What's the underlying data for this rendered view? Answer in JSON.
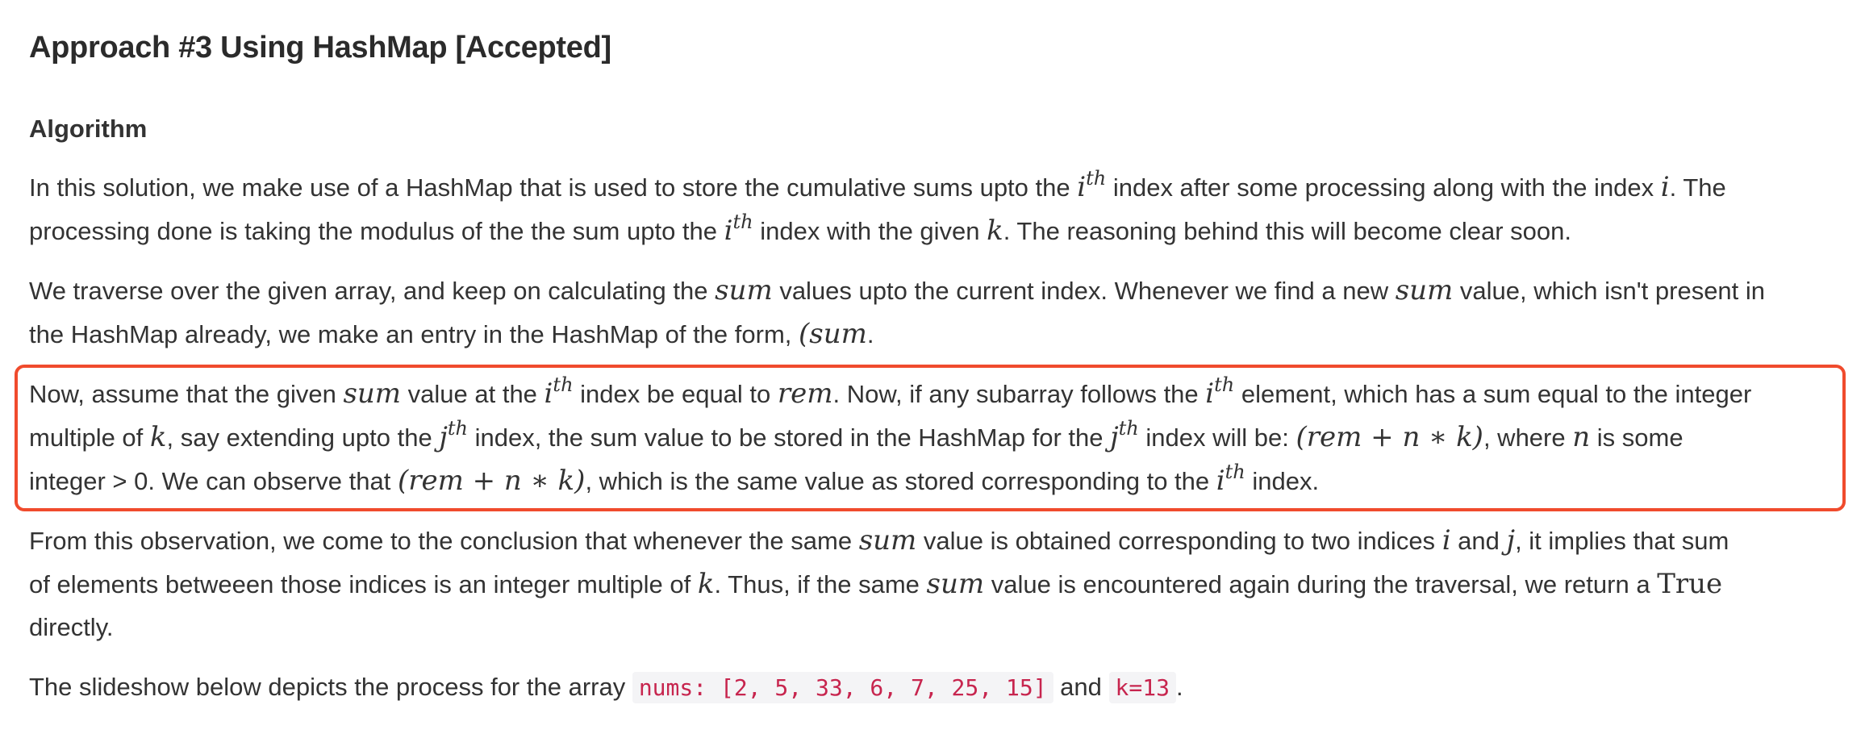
{
  "heading": "Approach #3 Using HashMap [Accepted]",
  "subheading": "Algorithm",
  "p1": {
    "l1": [
      "In this solution, we make use of a HashMap that is used to store the cumulative sums upto the ",
      "i",
      "th",
      " index after some processing along with the index ",
      "i",
      ". The"
    ],
    "l2": [
      "processing done is taking the modulus of the the sum upto the ",
      "i",
      "th",
      " index with the given ",
      "k",
      ". The reasoning behind this will become clear soon."
    ]
  },
  "p2": {
    "l1": [
      "We traverse over the given array, and keep on calculating the ",
      "sum",
      " values upto the current index. Whenever we find a new ",
      "sum",
      " value, which isn't present in"
    ],
    "l2": [
      "the HashMap already, we make an entry in the HashMap of the form, ",
      "(sum",
      "."
    ]
  },
  "p3": {
    "l1": [
      "Now, assume that the given ",
      "sum",
      " value at the ",
      "i",
      "th",
      " index be equal to ",
      "rem",
      ". Now, if any subarray follows the ",
      "i",
      "th",
      " element, which has a sum equal to the integer"
    ],
    "l2": [
      "multiple of ",
      "k",
      ", say extending upto the ",
      "j",
      "th",
      " index, the sum value to be stored in the HashMap for the ",
      "j",
      "th",
      " index will be: ",
      "(rem + n ∗ k)",
      ", where ",
      "n",
      " is some"
    ],
    "l3": [
      "integer > 0. We can observe that ",
      "(rem + n ∗ k)",
      ", which is the same value as stored corresponding to the ",
      "i",
      "th",
      " index."
    ]
  },
  "p4": {
    "l1": [
      "From this observation, we come to the conclusion that whenever the same ",
      "sum",
      " value is obtained corresponding to two indices ",
      "i",
      " and ",
      "j",
      ", it implies that sum"
    ],
    "l2": [
      "of elements betweeen those indices is an integer multiple of ",
      "k",
      ". Thus, if the same ",
      "sum",
      " value is encountered again during the traversal, we return a ",
      "True"
    ],
    "l3": [
      "directly."
    ]
  },
  "p5": {
    "t1": "The slideshow below depicts the process for the array ",
    "code1": "nums: [2, 5, 33, 6, 7, 25, 15]",
    "t2": " and ",
    "code2": "k=13",
    "t3": "."
  },
  "colors": {
    "highlight_border": "#f04b2d",
    "code_text": "#c7254e",
    "code_bg": "#f4f4f6"
  }
}
